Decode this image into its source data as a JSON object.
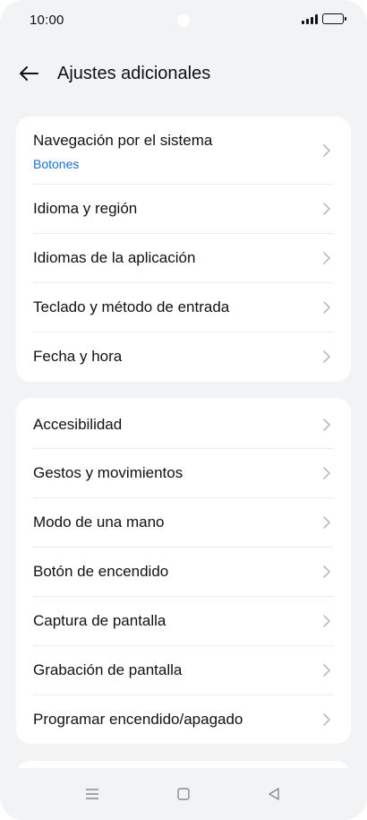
{
  "status_bar": {
    "time": "10:00"
  },
  "header": {
    "title": "Ajustes adicionales",
    "back_icon": "arrow-left-icon"
  },
  "groups": [
    {
      "items": [
        {
          "label": "Navegación por el sistema",
          "value": "Botones"
        },
        {
          "label": "Idioma y región"
        },
        {
          "label": "Idiomas de la aplicación"
        },
        {
          "label": "Teclado y método de entrada"
        },
        {
          "label": "Fecha y hora"
        }
      ]
    },
    {
      "items": [
        {
          "label": "Accesibilidad"
        },
        {
          "label": "Gestos y movimientos"
        },
        {
          "label": "Modo de una mano"
        },
        {
          "label": "Botón de encendido"
        },
        {
          "label": "Captura de pantalla"
        },
        {
          "label": "Grabación de pantalla"
        },
        {
          "label": "Programar encendido/apagado"
        }
      ]
    }
  ],
  "colors": {
    "accent": "#1a6fd9",
    "background": "#f2f3f5",
    "card": "#ffffff"
  },
  "nav_bar": {
    "icons": [
      "menu-icon",
      "home-square-icon",
      "back-triangle-icon"
    ]
  }
}
